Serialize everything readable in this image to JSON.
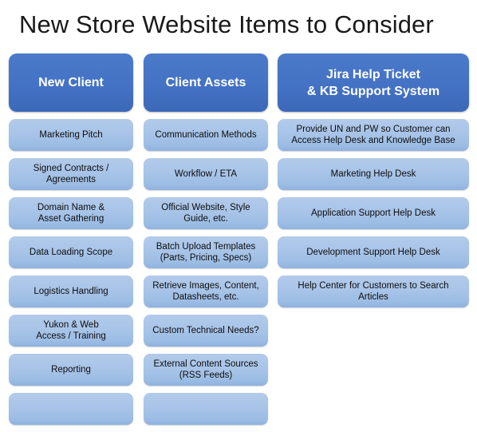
{
  "title": "New Store Website Items to Consider",
  "colors": {
    "header_blue": "#4472C4",
    "item_blue": "#A8C4E8",
    "title_text": "#1A1A1A",
    "header_text": "#FFFFFF",
    "item_text": "#0D0D0D",
    "background": "#FFFFFF"
  },
  "columns": [
    {
      "header": "New Client",
      "items": [
        "Marketing Pitch",
        "Signed Contracts /\nAgreements",
        "Domain Name &\nAsset Gathering",
        "Data Loading Scope",
        "Logistics Handling",
        "Yukon & Web\nAccess / Training",
        "Reporting",
        ""
      ]
    },
    {
      "header": "Client Assets",
      "items": [
        "Communication Methods",
        "Workflow / ETA",
        "Official Website, Style\nGuide, etc.",
        "Batch Upload Templates\n(Parts, Pricing, Specs)",
        "Retrieve Images, Content,\nDatasheets, etc.",
        "Custom Technical Needs?",
        "External Content Sources\n(RSS Feeds)",
        ""
      ]
    },
    {
      "header": "Jira Help Ticket\n& KB Support System",
      "items": [
        "Provide UN and PW so Customer can\nAccess Help Desk and Knowledge Base",
        "Marketing Help Desk",
        "Application Support Help Desk",
        "Development Support Help Desk",
        "Help Center for Customers to Search\nArticles"
      ]
    }
  ]
}
